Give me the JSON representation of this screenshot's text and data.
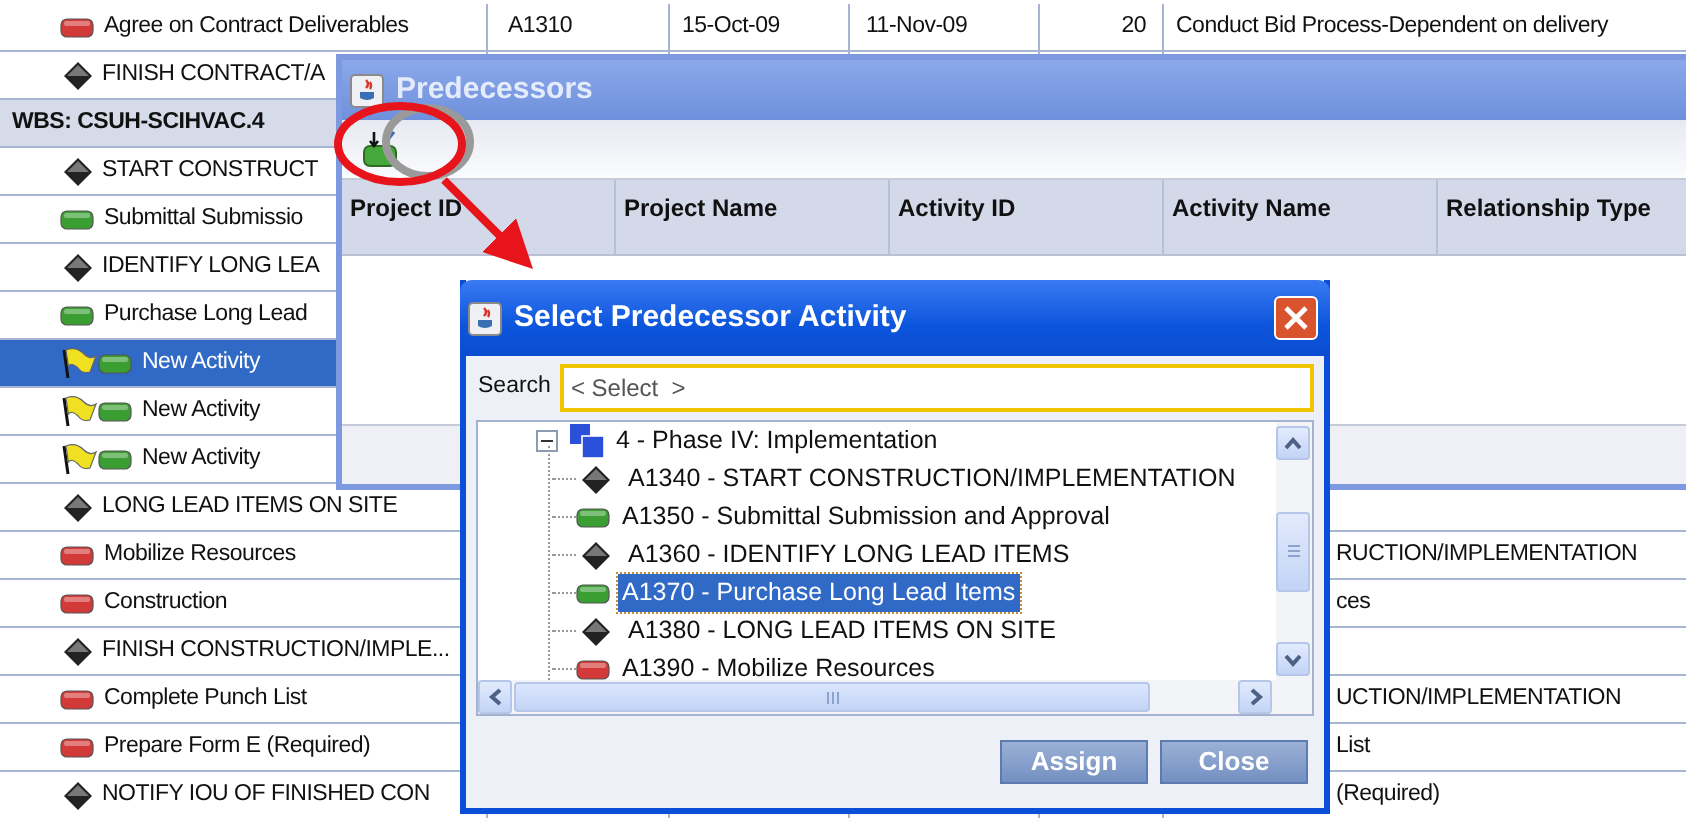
{
  "grid": {
    "rows": [
      {
        "kind": "task",
        "color": "#d23a3a",
        "flagged": false,
        "selected": false,
        "name": "Agree on Contract Deliverables",
        "id": "A1310",
        "start": "15-Oct-09",
        "finish": "11-Nov-09",
        "duration": "20",
        "description": "Conduct Bid Process-Dependent on delivery"
      },
      {
        "kind": "milestone",
        "flagged": false,
        "selected": false,
        "name": "FINISH CONTRACT/A"
      },
      {
        "kind": "wbs",
        "name": "WBS: CSUH-SCIHVAC.4"
      },
      {
        "kind": "milestone",
        "flagged": false,
        "selected": false,
        "name": "START CONSTRUCT"
      },
      {
        "kind": "task",
        "color": "#3a9e32",
        "flagged": false,
        "selected": false,
        "name": "Submittal Submissio"
      },
      {
        "kind": "milestone",
        "flagged": false,
        "selected": false,
        "name": "IDENTIFY LONG LEA"
      },
      {
        "kind": "task",
        "color": "#3a9e32",
        "flagged": false,
        "selected": false,
        "name": "Purchase Long Lead"
      },
      {
        "kind": "task",
        "color": "#3a9e32",
        "flagged": true,
        "selected": true,
        "name": "New Activity"
      },
      {
        "kind": "task",
        "color": "#3a9e32",
        "flagged": true,
        "selected": false,
        "name": "New Activity"
      },
      {
        "kind": "task",
        "color": "#3a9e32",
        "flagged": true,
        "selected": false,
        "name": "New Activity"
      },
      {
        "kind": "milestone",
        "flagged": false,
        "selected": false,
        "name": "LONG LEAD ITEMS ON SITE"
      },
      {
        "kind": "task",
        "color": "#d23a3a",
        "flagged": false,
        "selected": false,
        "name": "Mobilize Resources",
        "description": "RUCTION/IMPLEMENTATION"
      },
      {
        "kind": "task",
        "color": "#d23a3a",
        "flagged": false,
        "selected": false,
        "name": "Construction",
        "description": "ces"
      },
      {
        "kind": "milestone",
        "flagged": false,
        "selected": false,
        "name": "FINISH CONSTRUCTION/IMPLE..."
      },
      {
        "kind": "task",
        "color": "#d23a3a",
        "flagged": false,
        "selected": false,
        "name": "Complete Punch List",
        "description": "UCTION/IMPLEMENTATION"
      },
      {
        "kind": "task",
        "color": "#d23a3a",
        "flagged": false,
        "selected": false,
        "name": "Prepare Form E (Required)",
        "description": "List"
      },
      {
        "kind": "milestone",
        "flagged": false,
        "selected": false,
        "name": "NOTIFY IOU OF FINISHED CON",
        "description": "(Required)"
      }
    ]
  },
  "predecessors_dialog": {
    "title": "Predecessors",
    "columns": [
      "Project ID",
      "Project Name",
      "Activity ID",
      "Activity Name",
      "Relationship Type"
    ]
  },
  "select_dialog": {
    "title": "Select Predecessor Activity",
    "search_label": "Search",
    "search": {
      "placeholder": "< Select  >"
    },
    "tree": {
      "label": "4 - Phase IV: Implementation",
      "expanded": true,
      "children": [
        {
          "label": "A1340 - START CONSTRUCTION/IMPLEMENTATION",
          "kind": "milestone",
          "selected": false
        },
        {
          "label": "A1350 - Submittal Submission and Approval",
          "kind": "task",
          "color": "#3a9e32",
          "selected": false
        },
        {
          "label": "A1360 - IDENTIFY LONG LEAD ITEMS",
          "kind": "milestone",
          "selected": false
        },
        {
          "label": "A1370 - Purchase Long Lead Items",
          "kind": "task",
          "color": "#3a9e32",
          "selected": true
        },
        {
          "label": "A1380 - LONG LEAD ITEMS ON SITE",
          "kind": "milestone",
          "selected": false
        },
        {
          "label": "A1390 - Mobilize Resources",
          "kind": "task",
          "color": "#d23a3a",
          "selected": false
        }
      ]
    },
    "buttons": [
      "Assign",
      "Close"
    ]
  }
}
